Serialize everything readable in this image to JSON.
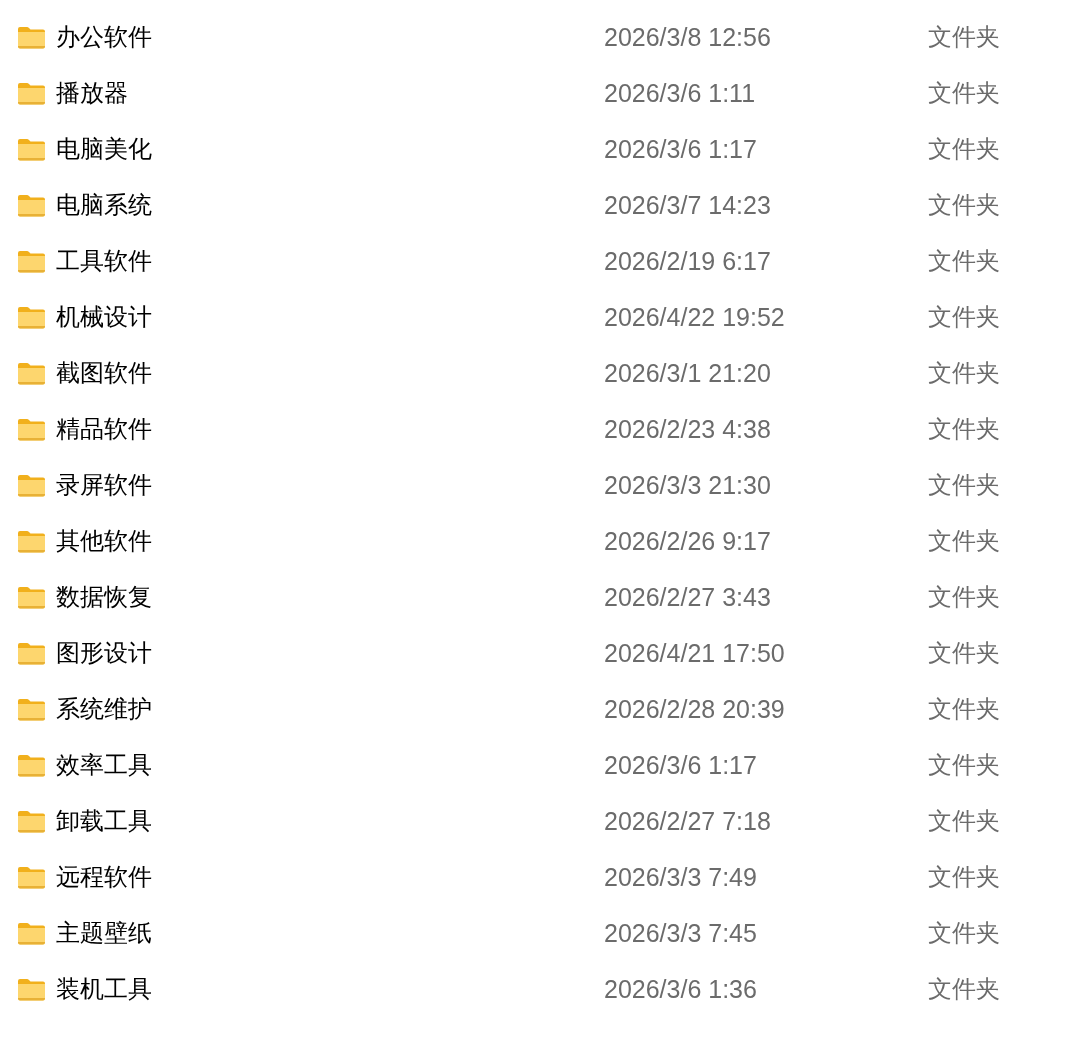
{
  "files": [
    {
      "name": "办公软件",
      "date_modified": "2026/3/8 12:56",
      "type": "文件夹",
      "selected": false
    },
    {
      "name": "播放器",
      "date_modified": "2026/3/6 1:11",
      "type": "文件夹",
      "selected": false
    },
    {
      "name": "电脑美化",
      "date_modified": "2026/3/6 1:17",
      "type": "文件夹",
      "selected": false
    },
    {
      "name": "电脑系统",
      "date_modified": "2026/3/7 14:23",
      "type": "文件夹",
      "selected": false
    },
    {
      "name": "工具软件",
      "date_modified": "2026/2/19 6:17",
      "type": "文件夹",
      "selected": false
    },
    {
      "name": "机械设计",
      "date_modified": "2026/4/22 19:52",
      "type": "文件夹",
      "selected": false
    },
    {
      "name": "截图软件",
      "date_modified": "2026/3/1 21:20",
      "type": "文件夹",
      "selected": false
    },
    {
      "name": "精品软件",
      "date_modified": "2026/2/23 4:38",
      "type": "文件夹",
      "selected": false
    },
    {
      "name": "录屏软件",
      "date_modified": "2026/3/3 21:30",
      "type": "文件夹",
      "selected": false
    },
    {
      "name": "其他软件",
      "date_modified": "2026/2/26 9:17",
      "type": "文件夹",
      "selected": false
    },
    {
      "name": "数据恢复",
      "date_modified": "2026/2/27 3:43",
      "type": "文件夹",
      "selected": false
    },
    {
      "name": "图形设计",
      "date_modified": "2026/4/21 17:50",
      "type": "文件夹",
      "selected": false
    },
    {
      "name": "系统维护",
      "date_modified": "2026/2/28 20:39",
      "type": "文件夹",
      "selected": false
    },
    {
      "name": "效率工具",
      "date_modified": "2026/3/6 1:17",
      "type": "文件夹",
      "selected": false
    },
    {
      "name": "卸载工具",
      "date_modified": "2026/2/27 7:18",
      "type": "文件夹",
      "selected": false
    },
    {
      "name": "远程软件",
      "date_modified": "2026/3/3 7:49",
      "type": "文件夹",
      "selected": false
    },
    {
      "name": "主题壁纸",
      "date_modified": "2026/3/3 7:45",
      "type": "文件夹",
      "selected": false
    },
    {
      "name": "装机工具",
      "date_modified": "2026/3/6 1:36",
      "type": "文件夹",
      "selected": false
    }
  ]
}
